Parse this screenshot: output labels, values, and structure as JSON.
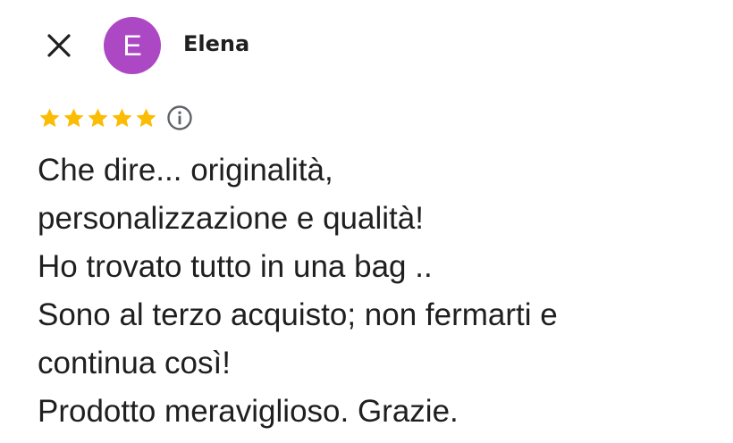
{
  "review": {
    "author_name": "Elena",
    "avatar_initial": "E",
    "avatar_color": "#ac48c3",
    "rating": 5,
    "rating_max": 5,
    "star_color": "#fbbc04",
    "text_lines": [
      "Che dire... originalità,",
      "personalizzazione e qualità!",
      "Ho trovato tutto in una bag ..",
      "Sono al terzo acquisto; non fermarti e",
      "continua così!",
      "Prodotto meraviglioso. Grazie."
    ]
  },
  "icons": {
    "close": "close-icon",
    "star": "star-icon",
    "info": "info-icon"
  },
  "colors": {
    "text": "#1f1f1f",
    "icon_gray": "#5f6368",
    "background": "#ffffff"
  }
}
